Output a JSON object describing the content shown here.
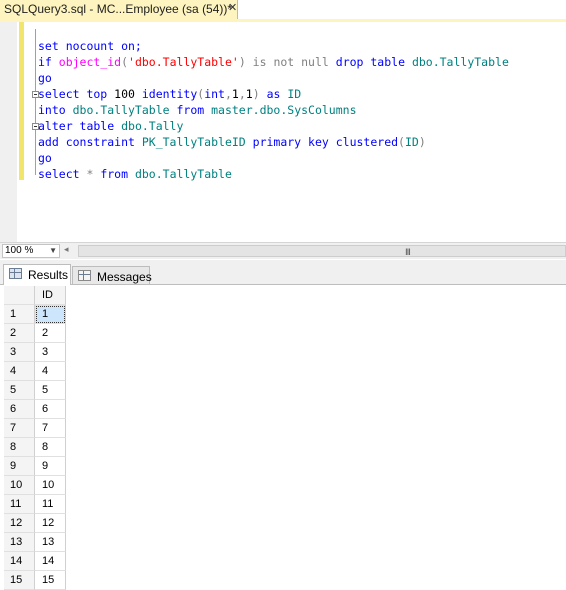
{
  "tab": {
    "title": "SQLQuery3.sql - MC...Employee (sa (54))*",
    "close": "✕"
  },
  "editor": {
    "lines": [
      {
        "segments": [
          {
            "t": "set nocount on;",
            "c": "kw"
          }
        ]
      },
      {
        "segments": [
          {
            "t": "if ",
            "c": "kw"
          },
          {
            "t": "object_id",
            "c": "fn"
          },
          {
            "t": "(",
            "c": "gr"
          },
          {
            "t": "'dbo.TallyTable'",
            "c": "str"
          },
          {
            "t": ") ",
            "c": "gr"
          },
          {
            "t": "is not null",
            "c": "gr"
          },
          {
            "t": " drop table ",
            "c": "kw"
          },
          {
            "t": "dbo.TallyTable",
            "c": "obj"
          }
        ]
      },
      {
        "segments": [
          {
            "t": "go",
            "c": "kw"
          }
        ]
      },
      {
        "segments": [
          {
            "t": "select top ",
            "c": "kw"
          },
          {
            "t": "100 ",
            "c": "plain"
          },
          {
            "t": "identity",
            "c": "kw"
          },
          {
            "t": "(",
            "c": "gr"
          },
          {
            "t": "int",
            "c": "kw"
          },
          {
            "t": ",",
            "c": "gr"
          },
          {
            "t": "1",
            "c": "plain"
          },
          {
            "t": ",",
            "c": "gr"
          },
          {
            "t": "1",
            "c": "plain"
          },
          {
            "t": ") ",
            "c": "gr"
          },
          {
            "t": "as ",
            "c": "kw"
          },
          {
            "t": "ID",
            "c": "obj"
          }
        ]
      },
      {
        "segments": [
          {
            "t": "into ",
            "c": "kw"
          },
          {
            "t": "dbo.TallyTable ",
            "c": "obj"
          },
          {
            "t": "from ",
            "c": "kw"
          },
          {
            "t": "master.dbo.SysColumns",
            "c": "obj"
          }
        ]
      },
      {
        "segments": [
          {
            "t": "alter table ",
            "c": "kw"
          },
          {
            "t": "dbo.Tally",
            "c": "obj"
          }
        ]
      },
      {
        "segments": [
          {
            "t": "add constraint ",
            "c": "kw"
          },
          {
            "t": "PK_TallyTableID ",
            "c": "obj"
          },
          {
            "t": "primary key clustered",
            "c": "kw"
          },
          {
            "t": "(",
            "c": "gr"
          },
          {
            "t": "ID",
            "c": "obj"
          },
          {
            "t": ")",
            "c": "gr"
          }
        ]
      },
      {
        "segments": [
          {
            "t": "go",
            "c": "kw"
          }
        ]
      },
      {
        "segments": [
          {
            "t": "select ",
            "c": "kw"
          },
          {
            "t": "* ",
            "c": "gr"
          },
          {
            "t": "from ",
            "c": "kw"
          },
          {
            "t": "dbo.TallyTable",
            "c": "obj"
          }
        ]
      }
    ]
  },
  "zoom": {
    "value": "100 %"
  },
  "results_tabs": {
    "results": "Results",
    "messages": "Messages"
  },
  "grid": {
    "column": "ID",
    "rows": [
      {
        "n": "1",
        "id": "1"
      },
      {
        "n": "2",
        "id": "2"
      },
      {
        "n": "3",
        "id": "3"
      },
      {
        "n": "4",
        "id": "4"
      },
      {
        "n": "5",
        "id": "5"
      },
      {
        "n": "6",
        "id": "6"
      },
      {
        "n": "7",
        "id": "7"
      },
      {
        "n": "8",
        "id": "8"
      },
      {
        "n": "9",
        "id": "9"
      },
      {
        "n": "10",
        "id": "10"
      },
      {
        "n": "11",
        "id": "11"
      },
      {
        "n": "12",
        "id": "12"
      },
      {
        "n": "13",
        "id": "13"
      },
      {
        "n": "14",
        "id": "14"
      },
      {
        "n": "15",
        "id": "15"
      }
    ]
  }
}
